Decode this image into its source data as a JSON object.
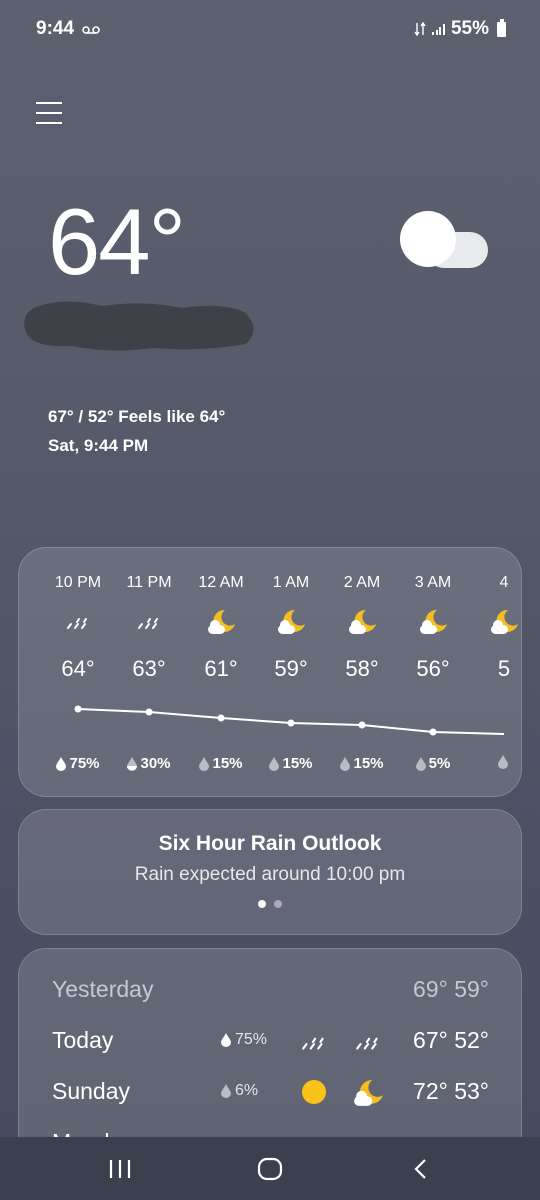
{
  "status_bar": {
    "time": "9:44",
    "battery": "55%"
  },
  "current": {
    "temperature": "64°",
    "hi_lo_feels": "67° / 52° Feels like 64°",
    "datetime": "Sat, 9:44 PM",
    "icon": "partly-cloudy-night-cloud-icon"
  },
  "hourly": [
    {
      "time": "10 PM",
      "temp": "64°",
      "precip": "75%",
      "icon": "rain-icon"
    },
    {
      "time": "11 PM",
      "temp": "63°",
      "precip": "30%",
      "icon": "rain-icon"
    },
    {
      "time": "12 AM",
      "temp": "61°",
      "precip": "15%",
      "icon": "moon-cloud-icon"
    },
    {
      "time": "1 AM",
      "temp": "59°",
      "precip": "15%",
      "icon": "moon-cloud-icon"
    },
    {
      "time": "2 AM",
      "temp": "58°",
      "precip": "15%",
      "icon": "moon-cloud-icon"
    },
    {
      "time": "3 AM",
      "temp": "56°",
      "precip": "5%",
      "icon": "moon-cloud-icon"
    },
    {
      "time": "4",
      "temp": "5",
      "precip": "",
      "icon": "moon-cloud-icon"
    }
  ],
  "rain_outlook": {
    "title": "Six Hour Rain Outlook",
    "text": "Rain expected around 10:00 pm"
  },
  "daily": [
    {
      "day": "Yesterday",
      "precip": "",
      "temps": "69° 59°"
    },
    {
      "day": "Today",
      "precip": "75%",
      "temps": "67° 52°",
      "icons": [
        "rain-icon",
        "rain-icon"
      ]
    },
    {
      "day": "Sunday",
      "precip": "6%",
      "temps": "72° 53°",
      "icons": [
        "sun-icon",
        "moon-cloud-icon"
      ]
    },
    {
      "day": "Monday",
      "precip": "",
      "temps": "",
      "icons": []
    }
  ],
  "colors": {
    "sun": "#f9c31a",
    "moon": "#f6bd22"
  }
}
